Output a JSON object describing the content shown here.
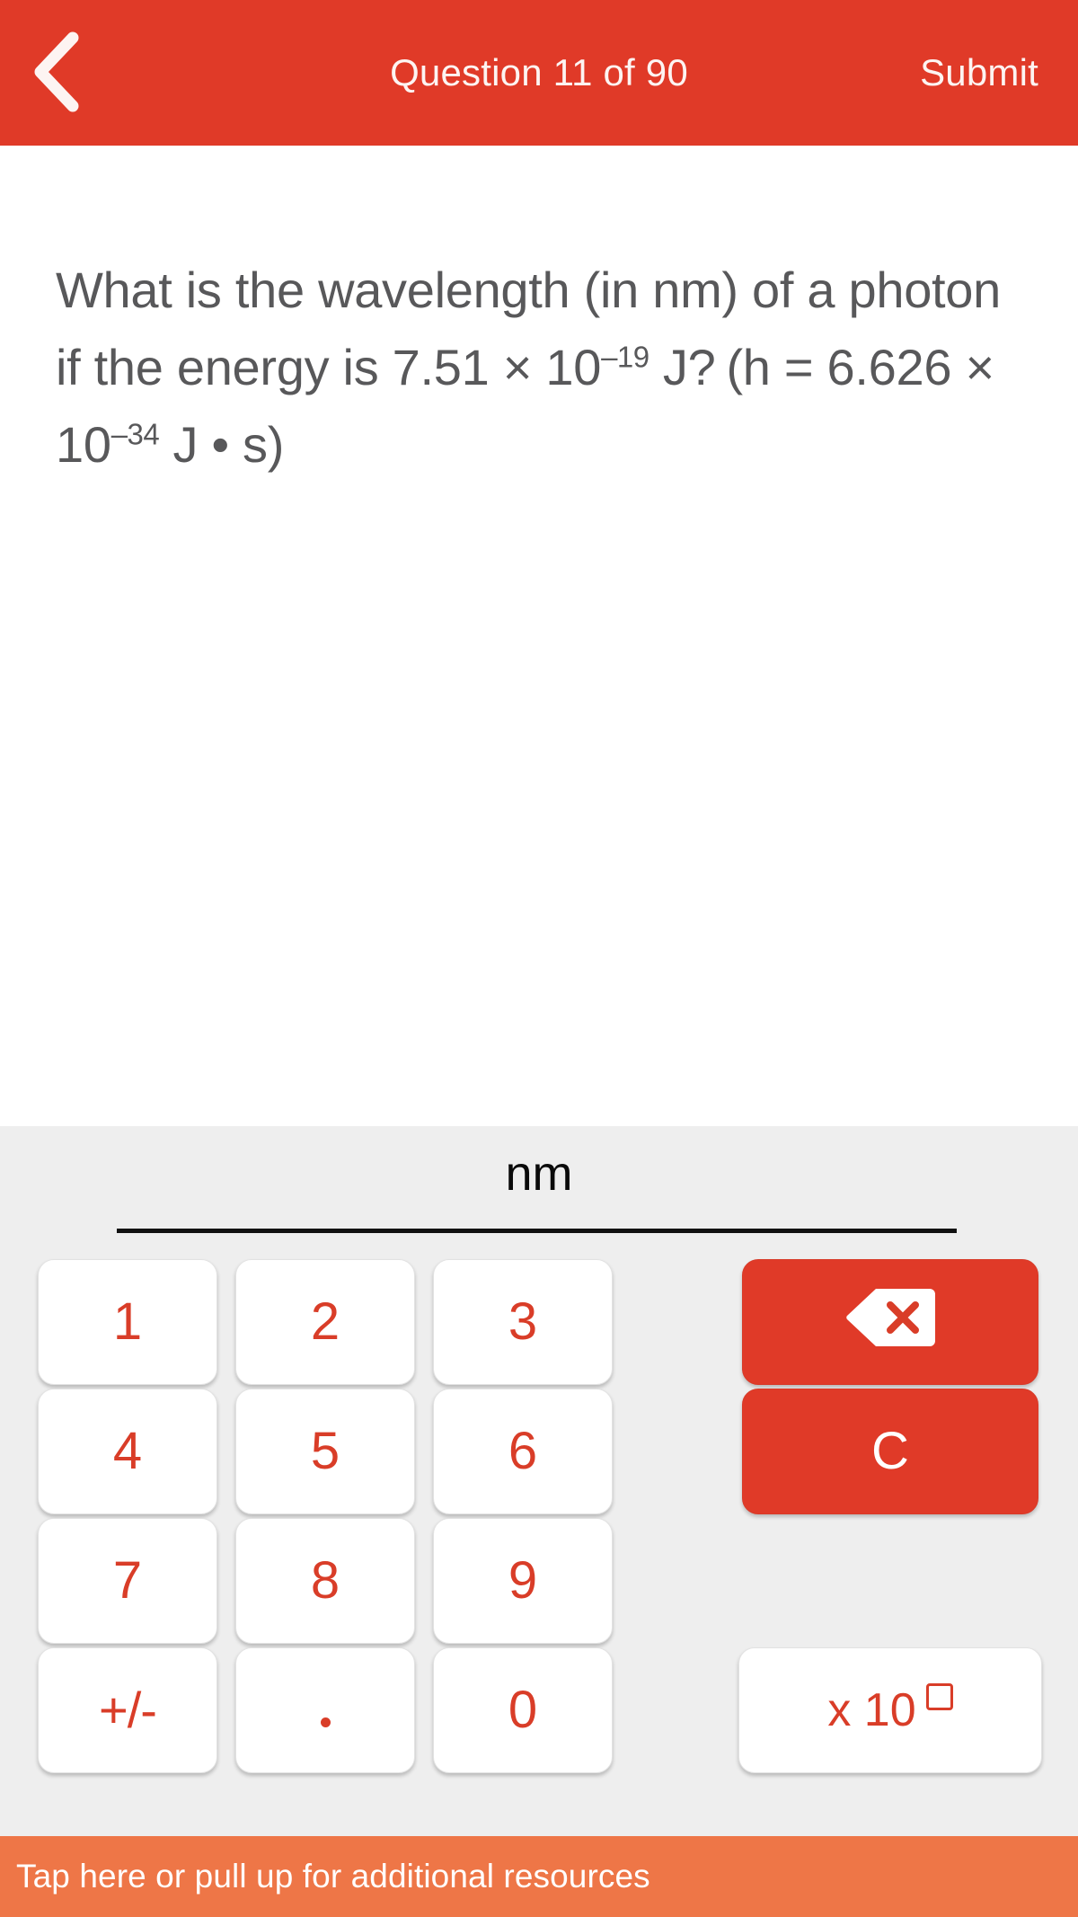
{
  "header": {
    "back_icon": "chevron-left-icon",
    "title": "Question 11 of 90",
    "submit_label": "Submit",
    "background_color": "#E03A28",
    "text_color": "#FDF4F2"
  },
  "question": {
    "line1": "What is the wavelength (in nm) of a",
    "line2_a": "photon if the energy is 7.51 × 10",
    "line2_sup": "–19",
    "line3_a": "J?",
    "line3_b": "(h = 6.626 × 10",
    "line3_sup": "–34",
    "line3_c": " J • s)",
    "full_text": "What is the wavelength (in nm) of a photon if the energy is 7.51 × 10⁻¹⁹ J?  (h = 6.626 × 10⁻³⁴ J • s)",
    "text_color": "#58585A"
  },
  "answer": {
    "unit": "nm",
    "value": "",
    "placeholder": ""
  },
  "keypad": {
    "background_color": "#EEEEEE",
    "key_text_color": "#D93D28",
    "accent_color": "#E03A28",
    "keys": [
      {
        "label": "1",
        "name": "key-1",
        "type": "digit"
      },
      {
        "label": "2",
        "name": "key-2",
        "type": "digit"
      },
      {
        "label": "3",
        "name": "key-3",
        "type": "digit"
      },
      {
        "label": "4",
        "name": "key-4",
        "type": "digit"
      },
      {
        "label": "5",
        "name": "key-5",
        "type": "digit"
      },
      {
        "label": "6",
        "name": "key-6",
        "type": "digit"
      },
      {
        "label": "7",
        "name": "key-7",
        "type": "digit"
      },
      {
        "label": "8",
        "name": "key-8",
        "type": "digit"
      },
      {
        "label": "9",
        "name": "key-9",
        "type": "digit"
      },
      {
        "label": "+/-",
        "name": "key-sign",
        "type": "function"
      },
      {
        "label": ".",
        "name": "key-decimal",
        "type": "function"
      },
      {
        "label": "0",
        "name": "key-0",
        "type": "digit"
      }
    ],
    "backspace": {
      "icon": "backspace-icon",
      "label": ""
    },
    "clear": {
      "label": "C",
      "name": "key-clear"
    },
    "scientific": {
      "label_prefix": "x 10",
      "exponent_placeholder": "□",
      "name": "key-scientific-notation"
    }
  },
  "bottom_bar": {
    "text": "Tap here or pull up for additional resources",
    "background_color": "#EE7647",
    "text_color": "#FFFFFF"
  }
}
